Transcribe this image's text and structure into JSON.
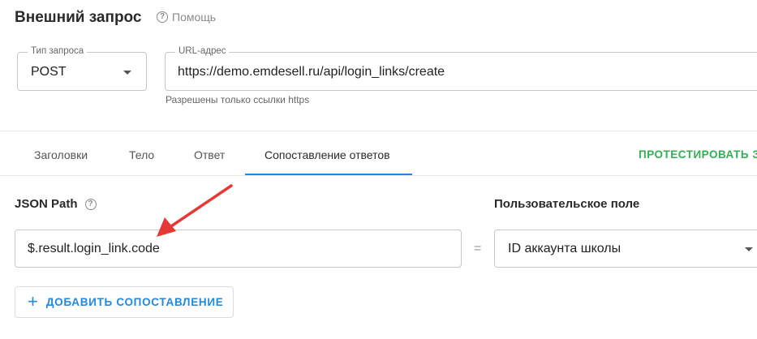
{
  "header": {
    "title": "Внешний запрос",
    "help_label": "Помощь"
  },
  "request_type": {
    "label": "Тип запроса",
    "value": "POST"
  },
  "url": {
    "label": "URL-адрес",
    "value": "https://demo.emdesell.ru/api/login_links/create",
    "hint": "Разрешены только ссылки https"
  },
  "tabs": [
    {
      "label": "Заголовки"
    },
    {
      "label": "Тело"
    },
    {
      "label": "Ответ"
    },
    {
      "label": "Сопоставление ответов",
      "active": true
    }
  ],
  "test_button_label": "ПРОТЕСТИРОВАТЬ З",
  "mapping": {
    "json_path_label": "JSON Path",
    "json_path_value": "$.result.login_link.code",
    "equals": "=",
    "custom_field_label": "Пользовательское поле",
    "custom_field_value": "ID аккаунта школы"
  },
  "add_mapping_label": "ДОБАВИТЬ СОПОСТАВЛЕНИЕ",
  "colors": {
    "accent": "#1e88e5",
    "test": "#2fb152",
    "arrow": "#e53935"
  }
}
